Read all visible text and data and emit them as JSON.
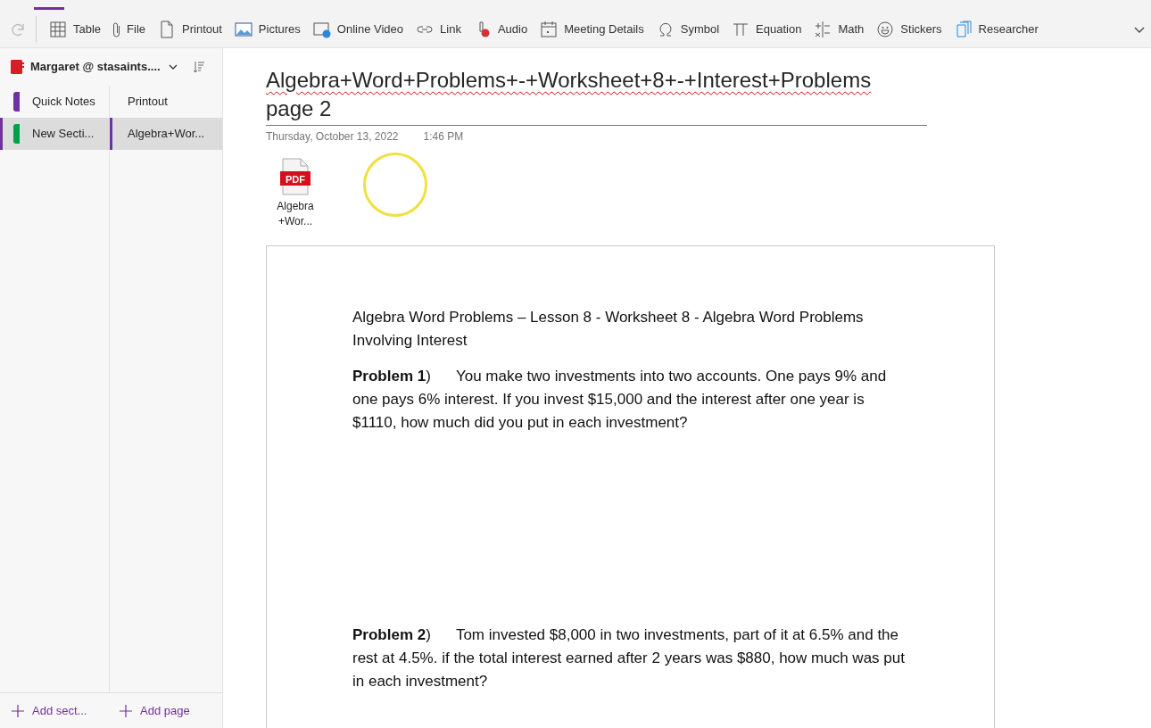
{
  "toolbar": {
    "redo_disabled": true,
    "items": [
      {
        "kind": "table",
        "label": "Table"
      },
      {
        "kind": "file",
        "label": "File"
      },
      {
        "kind": "printout",
        "label": "Printout"
      },
      {
        "kind": "pictures",
        "label": "Pictures"
      },
      {
        "kind": "video",
        "label": "Online Video"
      },
      {
        "kind": "link",
        "label": "Link"
      },
      {
        "kind": "audio",
        "label": "Audio"
      },
      {
        "kind": "meeting",
        "label": "Meeting Details"
      },
      {
        "kind": "symbol",
        "label": "Symbol"
      },
      {
        "kind": "equation",
        "label": "Equation"
      },
      {
        "kind": "math",
        "label": "Math"
      },
      {
        "kind": "stickers",
        "label": "Stickers"
      },
      {
        "kind": "researcher",
        "label": "Researcher"
      }
    ]
  },
  "notebook": {
    "name": "Margaret @ stasaints...."
  },
  "sections": [
    {
      "label": "Quick Notes",
      "color": "#7030a0",
      "selected": false
    },
    {
      "label": "New Secti...",
      "color": "#00a04a",
      "selected": true
    }
  ],
  "pages": [
    {
      "label": "Printout",
      "selected": false
    },
    {
      "label": "Algebra+Wor...",
      "selected": true
    }
  ],
  "add_section": "Add sect...",
  "add_page": "Add page",
  "page": {
    "title_line_1": "Algebra+Word+Problems+-+Worksheet+8+-+Interest+Problems",
    "title_line_2": "page 2",
    "date": "Thursday, October 13, 2022",
    "time": "1:46 PM",
    "attachment": {
      "badge": "PDF",
      "name": "Algebra\n+Wor..."
    },
    "printout": {
      "heading": "Algebra Word Problems – Lesson 8 - Worksheet 8 - Algebra Word Problems Involving Interest",
      "problems": [
        "**Problem 1**)      You make two investments into two accounts. One pays 9% and one pays 6% interest. If you invest $15,000 and the interest after one year is $1110, how much did you put in each investment?",
        "**Problem 2**)      Tom invested $8,000 in two investments, part of it at 6.5% and the rest at 4.5%. if the total interest earned after 2 years was $880, how much was put in each investment?"
      ]
    }
  }
}
